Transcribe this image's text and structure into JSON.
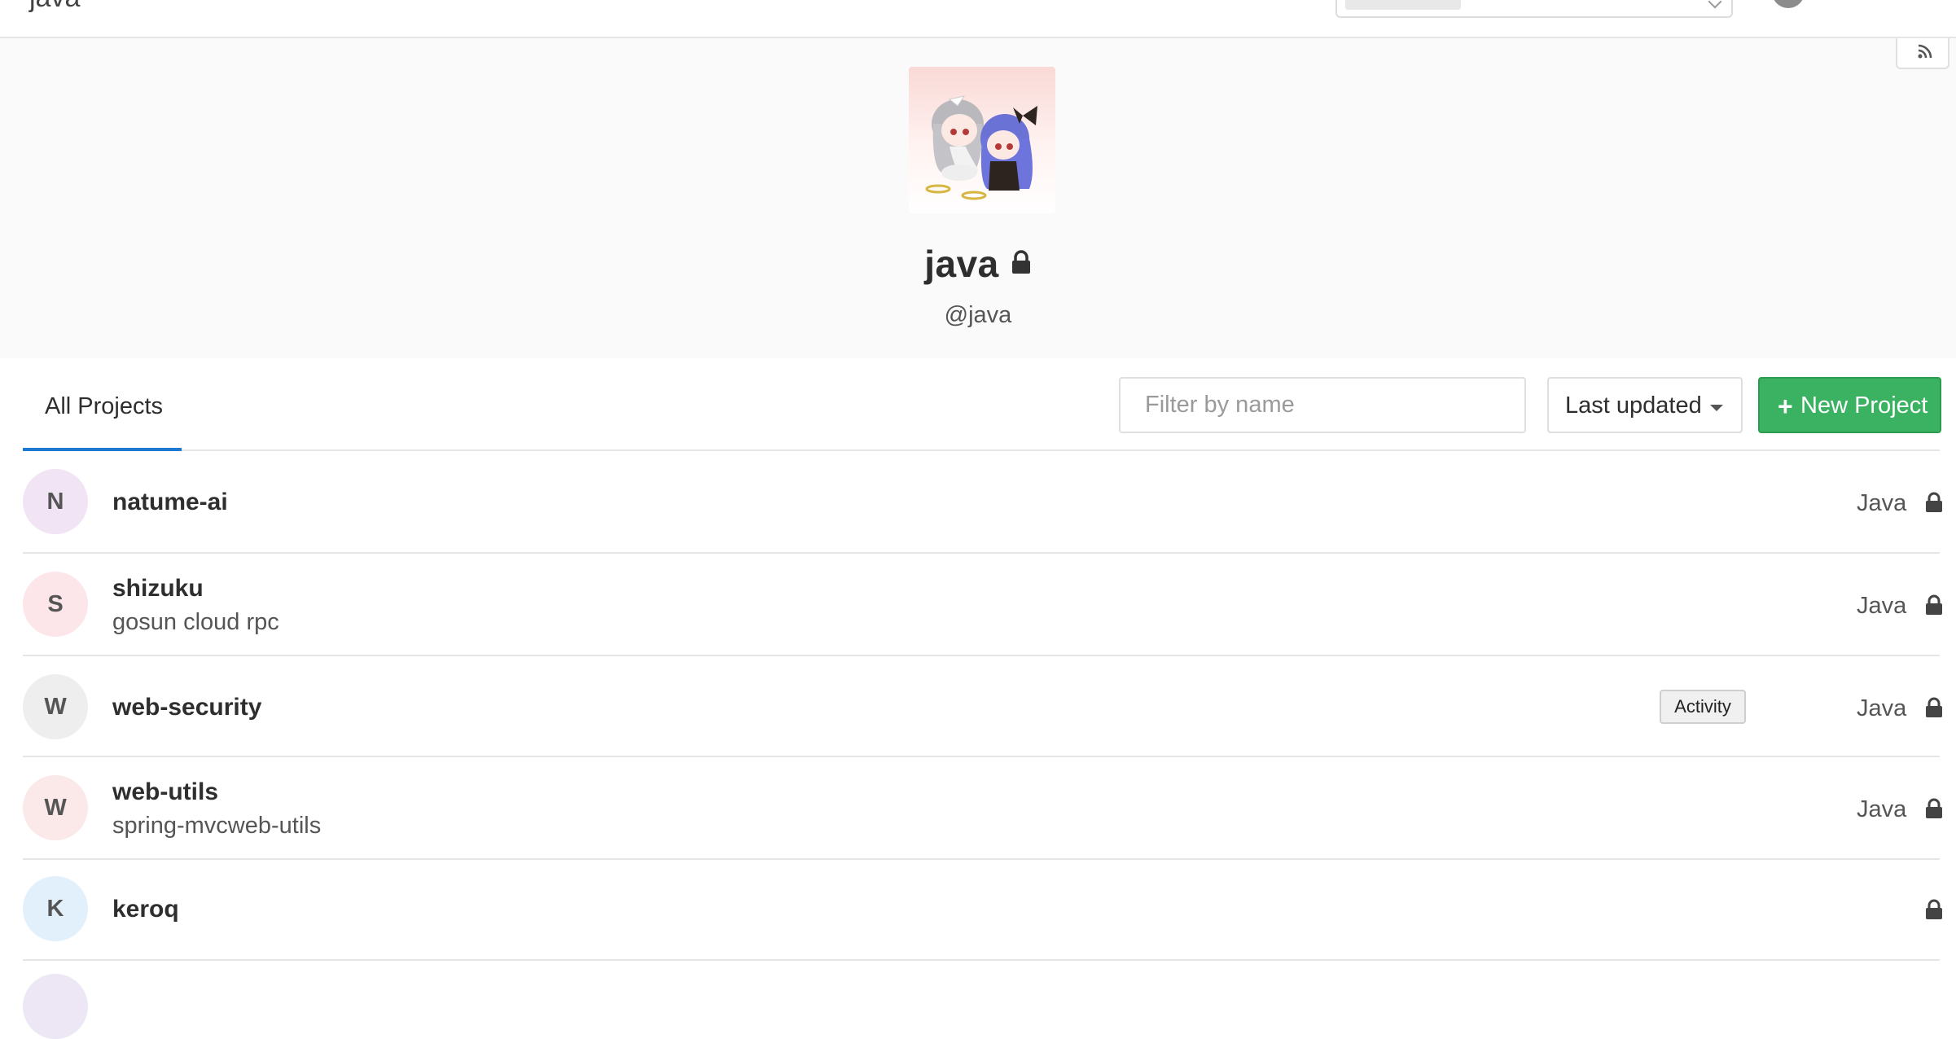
{
  "topbar": {
    "title": "java"
  },
  "group": {
    "name": "java",
    "handle": "@java"
  },
  "tabs": {
    "all_projects": "All Projects"
  },
  "controls": {
    "filter_placeholder": "Filter by name",
    "sort_label": "Last updated",
    "new_project_label": "New Project"
  },
  "colors": {
    "new_project_bg": "#3bb262",
    "active_tab_underline": "#1f78d1"
  },
  "projects": [
    {
      "initial": "N",
      "name": "natume-ai",
      "description": "",
      "language": "Java",
      "avatar_color": "#f1e4f4",
      "private": true
    },
    {
      "initial": "S",
      "name": "shizuku",
      "description": "gosun cloud rpc",
      "language": "Java",
      "avatar_color": "#fde6ea",
      "private": true
    },
    {
      "initial": "W",
      "name": "web-security",
      "description": "",
      "language": "Java",
      "avatar_color": "#eeeeee",
      "private": true
    },
    {
      "initial": "W",
      "name": "web-utils",
      "description": "spring-mvcweb-utils",
      "language": "Java",
      "avatar_color": "#fbe8e8",
      "private": true
    },
    {
      "initial": "K",
      "name": "keroq",
      "description": "",
      "language": "",
      "avatar_color": "#e2f0fc",
      "private": true
    }
  ],
  "tooltip": {
    "activity": "Activity"
  }
}
